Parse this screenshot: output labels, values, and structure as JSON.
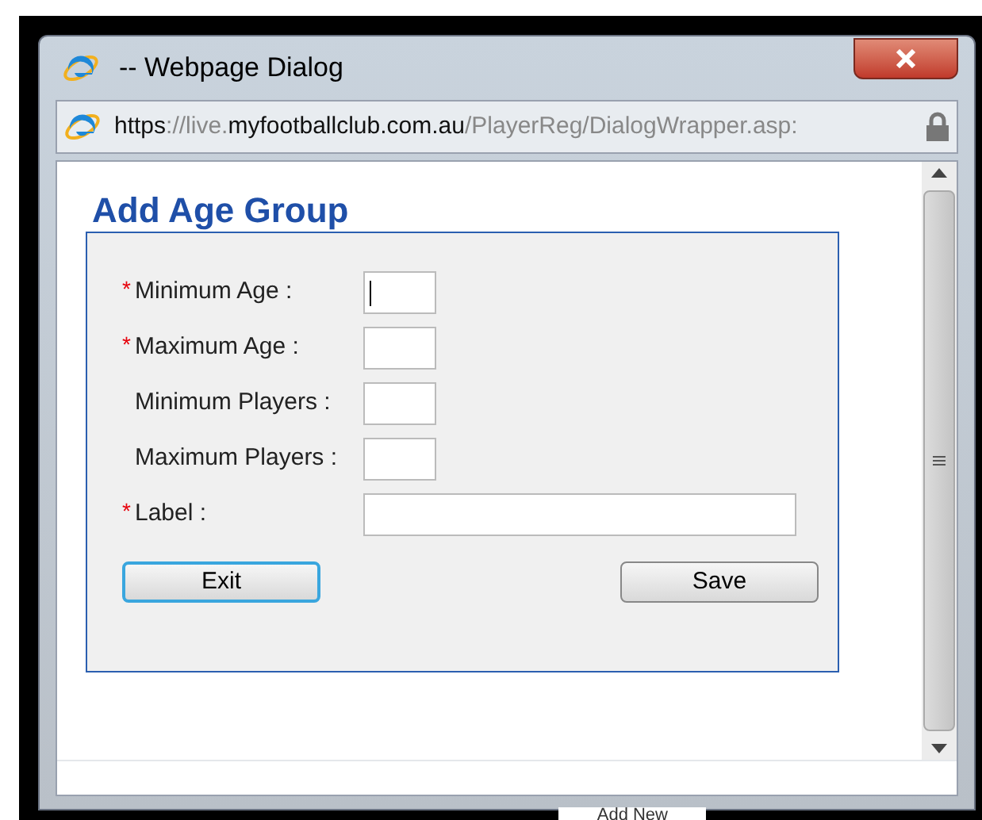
{
  "window": {
    "title": "-- Webpage Dialog"
  },
  "address_bar": {
    "url_parts": [
      {
        "text": "https",
        "dim": false
      },
      {
        "text": "://live.",
        "dim": true
      },
      {
        "text": "myfootballclub.com.au",
        "dim": false
      },
      {
        "text": "/PlayerReg/DialogWrapper.asp:",
        "dim": true
      }
    ]
  },
  "form": {
    "heading": "Add Age Group",
    "fields": [
      {
        "label": "Minimum Age :",
        "required": true,
        "kind": "short",
        "focused": true
      },
      {
        "label": "Maximum Age :",
        "required": true,
        "kind": "short",
        "focused": false
      },
      {
        "label": "Minimum Players :",
        "required": false,
        "kind": "short",
        "focused": false
      },
      {
        "label": "Maximum Players :",
        "required": false,
        "kind": "short",
        "focused": false
      },
      {
        "label": "Label :",
        "required": true,
        "kind": "long",
        "focused": false
      }
    ],
    "required_mark": "*",
    "buttons": [
      {
        "label": "Exit",
        "focused": true
      },
      {
        "label": "Save",
        "focused": false
      }
    ]
  },
  "background_page": {
    "button": "Add New"
  }
}
